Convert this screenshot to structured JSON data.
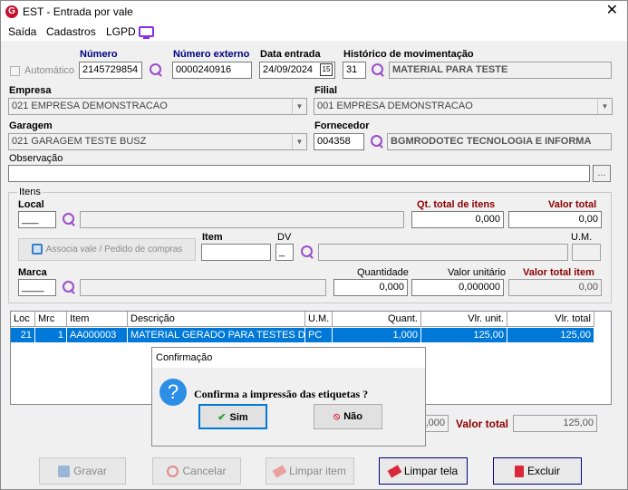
{
  "window": {
    "title": "EST - Entrada por vale",
    "close_glyph": "✕",
    "logo_letter": "G"
  },
  "menu": {
    "items": [
      "Saída",
      "Cadastros",
      "LGPD"
    ]
  },
  "header": {
    "automatico_label": "Automático",
    "numero_label": "Número",
    "numero_value": "2145729854",
    "numero_externo_label": "Número externo",
    "numero_externo_value": "0000240916",
    "data_entrada_label": "Data entrada",
    "data_entrada_value": "24/09/2024",
    "calendar_glyph": "15",
    "historico_label": "Histórico de movimentação",
    "historico_code": "31",
    "historico_desc": "MATERIAL PARA TESTE",
    "empresa_label": "Empresa",
    "empresa_value": "021 EMPRESA DEMONSTRACAO",
    "filial_label": "Filial",
    "filial_value": "001 EMPRESA DEMONSTRACAO",
    "garagem_label": "Garagem",
    "garagem_value": "021 GARAGEM TESTE BUSZ",
    "fornecedor_label": "Fornecedor",
    "fornecedor_code": "004358",
    "fornecedor_desc": "BGMRODOTEC TECNOLOGIA E INFORMA",
    "observacao_label": "Observação",
    "observacao_value": "",
    "observacao_btn": "..."
  },
  "itens": {
    "group_label": "Itens",
    "local_label": "Local",
    "local_value": "___",
    "qt_total_label": "Qt. total de itens",
    "qt_total_value": "0,000",
    "valor_total_label": "Valor total",
    "valor_total_value": "0,00",
    "associa_btn": "Associa vale / Pedido de compras",
    "item_label": "Item",
    "dv_label": "DV",
    "dv_value": "_",
    "um_label": "U.M.",
    "marca_label": "Marca",
    "marca_value": "____",
    "quantidade_label": "Quantidade",
    "quantidade_value": "0,000",
    "valor_unitario_label": "Valor unitário",
    "valor_unitario_value": "0,000000",
    "valor_total_item_label": "Valor total item",
    "valor_total_item_value": "0,00"
  },
  "grid": {
    "columns": [
      "Loc",
      "Mrc",
      "Item",
      "Descrição",
      "U.M.",
      "Quant.",
      "Vlr. unit.",
      "Vlr. total"
    ],
    "rows": [
      [
        "21",
        "1",
        "AA000003",
        "MATERIAL GERADO PARA TESTES D",
        "PC",
        "1,000",
        "125,00",
        "125,00"
      ]
    ]
  },
  "totals": {
    "qt_partial": ",000",
    "valor_total_label": "Valor total",
    "valor_total_value": "125,00"
  },
  "buttons": {
    "gravar": "Gravar",
    "cancelar": "Cancelar",
    "limpar_item": "Limpar item",
    "limpar_tela": "Limpar tela",
    "excluir": "Excluir"
  },
  "dialog": {
    "title": "Confirmação",
    "message": "Confirma a impressão das etiquetas ?",
    "yes": "Sim",
    "no": "Não",
    "icon": "?"
  },
  "colors": {
    "accent": "#0078d7",
    "required_label": "#000080",
    "total_label": "#8b0000",
    "icon": "#9b4dca"
  }
}
